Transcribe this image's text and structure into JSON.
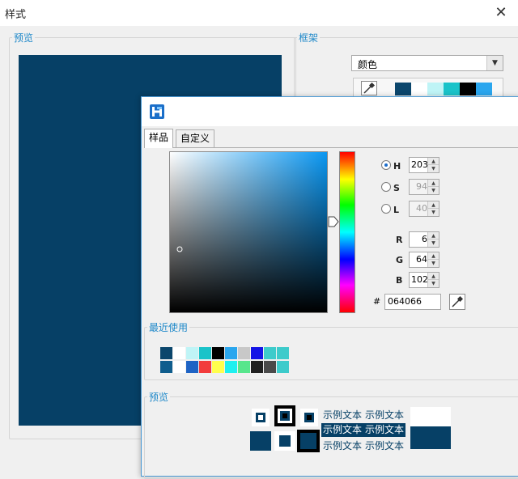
{
  "outer_dialog": {
    "title": "样式",
    "close_glyph": "✕",
    "preview_group_label": "预览",
    "frame_group_label": "框架",
    "frame_combo_value": "颜色",
    "frame_swatches": [
      "#0b466c",
      "#ffffff",
      "#bff4f6",
      "#1ac3c9",
      "#000000",
      "#2aa6ee"
    ]
  },
  "picker": {
    "tabs": [
      {
        "label": "样品",
        "active": true
      },
      {
        "label": "自定义",
        "active": false
      }
    ],
    "current_color": "#064066",
    "sat_marker": {
      "s": 0.06,
      "v": 0.4
    },
    "hue_degrees": 203,
    "fields": {
      "H": {
        "label": "H",
        "value": "203",
        "selected": true,
        "enabled": true
      },
      "S": {
        "label": "S",
        "value": "94",
        "selected": false,
        "enabled": false
      },
      "L": {
        "label": "L",
        "value": "40",
        "selected": false,
        "enabled": false
      },
      "R": {
        "label": "R",
        "value": "6"
      },
      "G": {
        "label": "G",
        "value": "64"
      },
      "B": {
        "label": "B",
        "value": "102"
      }
    },
    "hex": {
      "hash": "#",
      "value": "064066"
    },
    "recent_label": "最近使用",
    "recent_rows": [
      [
        "#0b466c",
        "#ffffff",
        "#bff4f6",
        "#1ac3c9",
        "#000000",
        "#2aa6ee",
        "#c8c8c8",
        "#1414e6",
        "#3dcbcb",
        "#3dcbcb"
      ],
      [
        "#0f5d8d",
        "#ffffff",
        "#1e63c4",
        "#f23c3c",
        "#ffff4d",
        "#1ef0f0",
        "#57e68c",
        "#202020",
        "#4a4a4a",
        "#3dcbcb"
      ]
    ],
    "preview_label": "预览",
    "sample_text": "示例文本"
  }
}
